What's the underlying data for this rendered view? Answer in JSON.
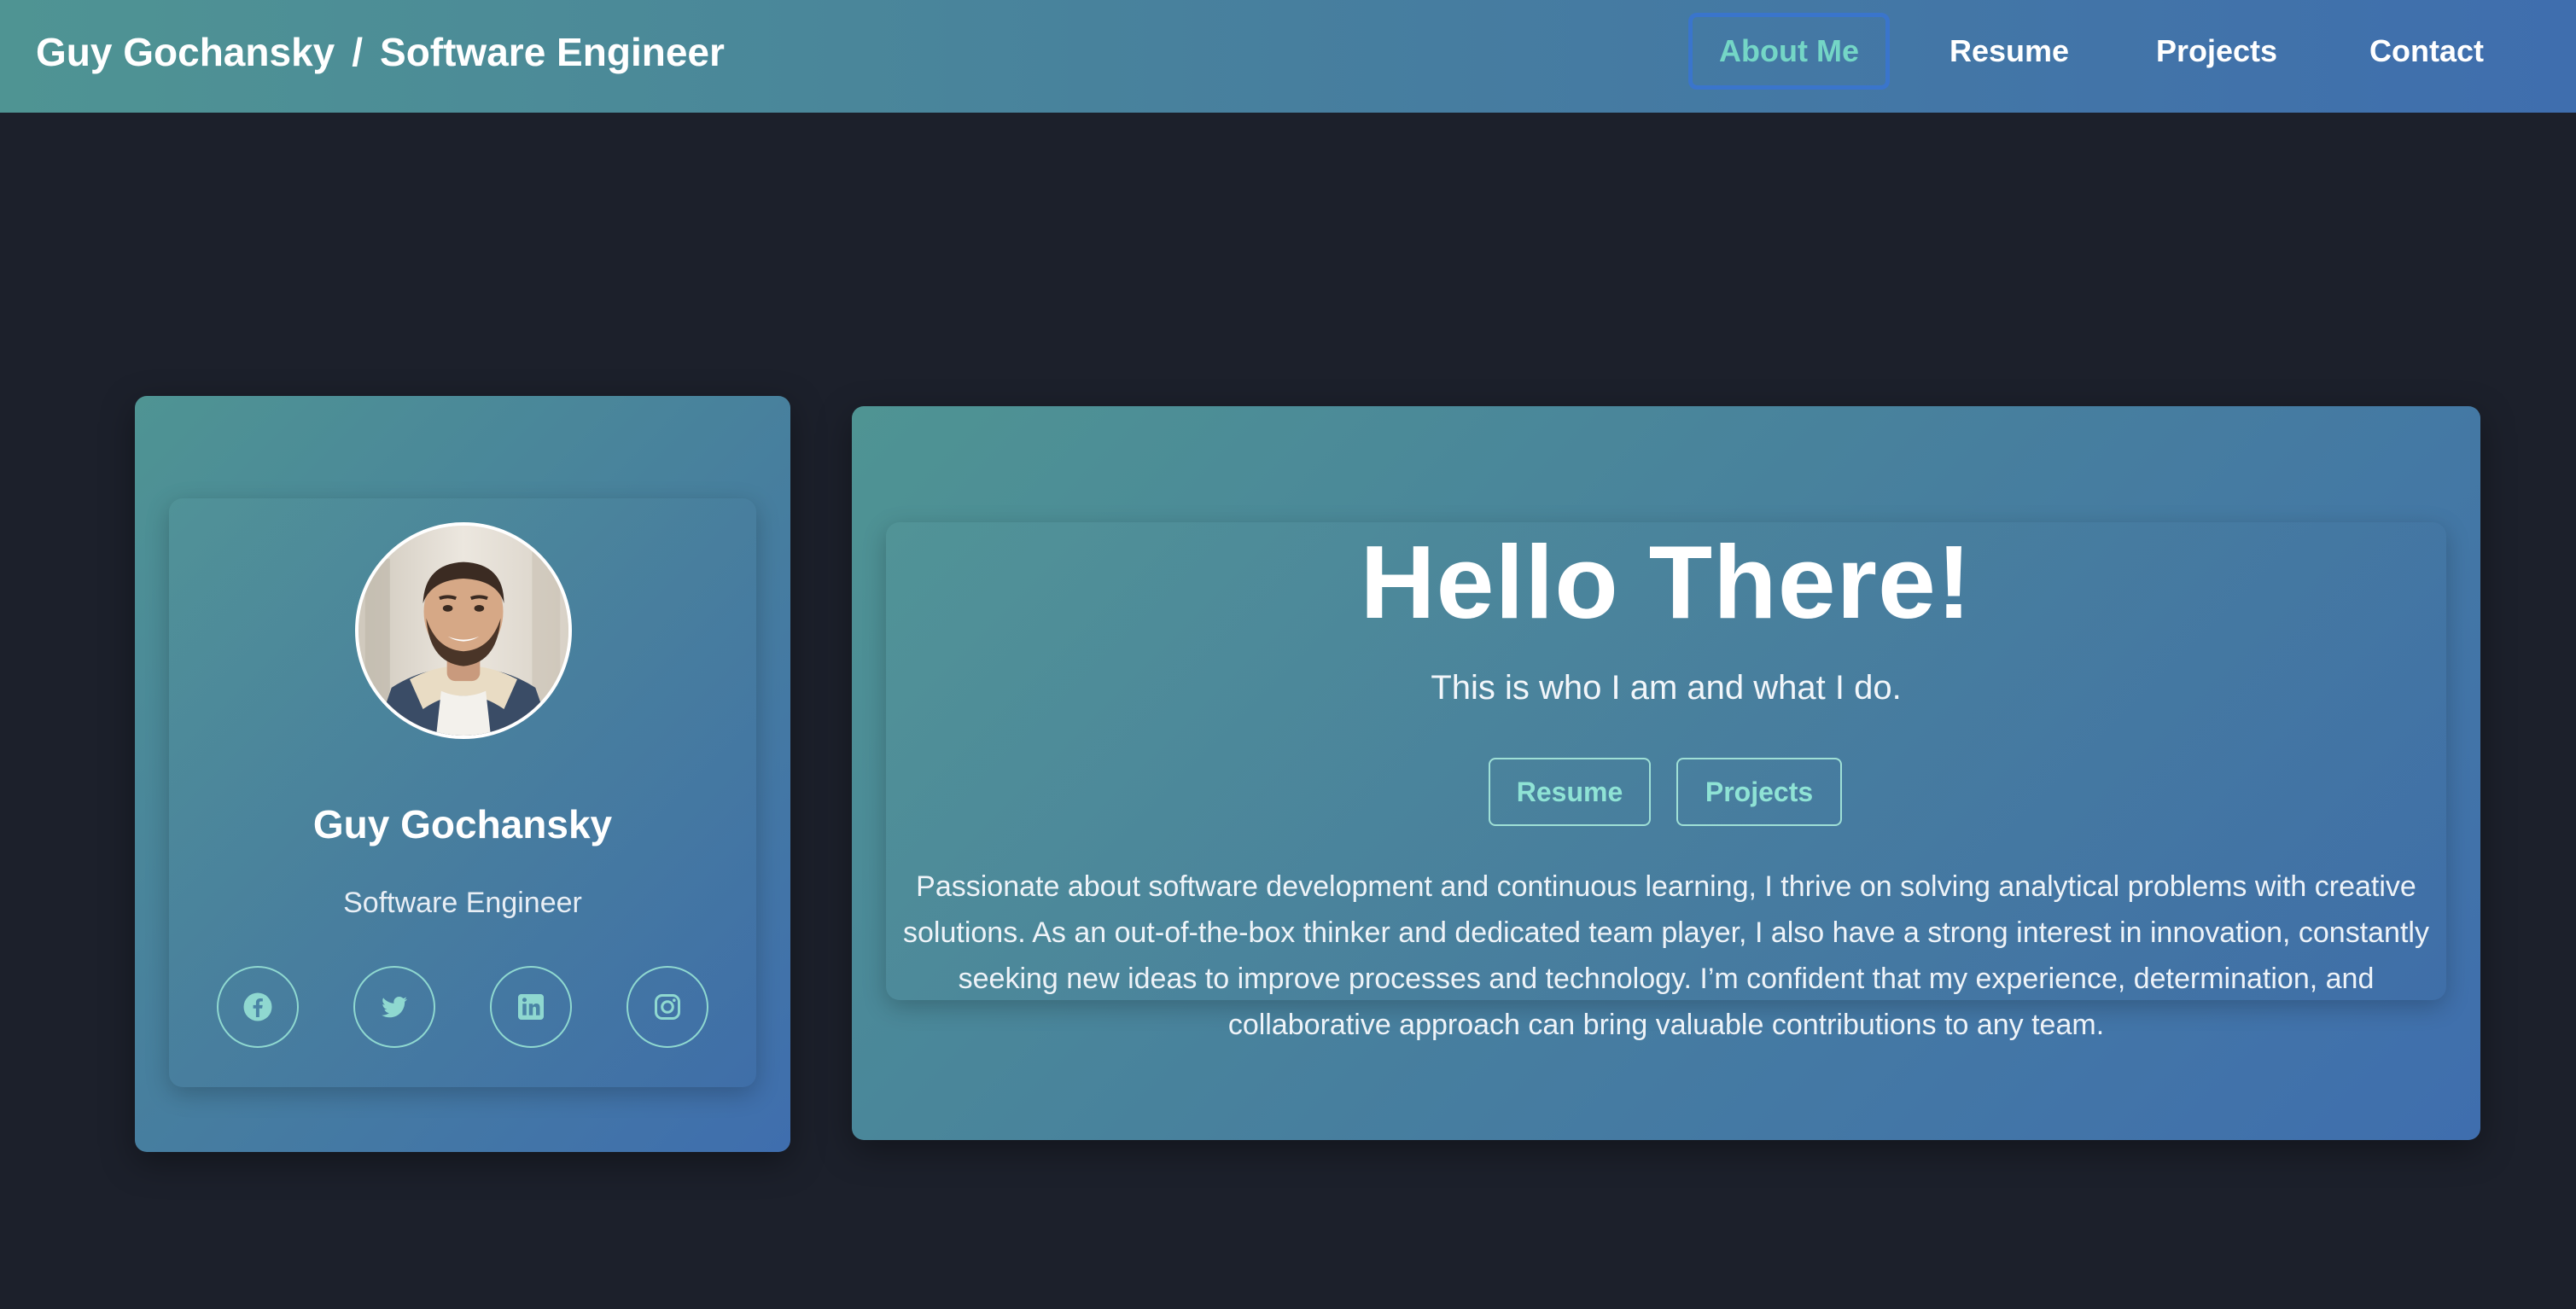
{
  "header": {
    "brand_name": "Guy Gochansky",
    "brand_separator": "/",
    "brand_role": "Software Engineer",
    "nav": [
      {
        "label": "About Me",
        "active": true
      },
      {
        "label": "Resume",
        "active": false
      },
      {
        "label": "Projects",
        "active": false
      },
      {
        "label": "Contact",
        "active": false
      }
    ]
  },
  "profile": {
    "name": "Guy Gochansky",
    "title": "Software Engineer",
    "social_icons": [
      "facebook-icon",
      "twitter-icon",
      "linkedin-icon",
      "instagram-icon"
    ]
  },
  "hero": {
    "heading": "Hello There!",
    "subtitle": "This is who I am and what I do.",
    "buttons": [
      {
        "label": "Resume"
      },
      {
        "label": "Projects"
      }
    ],
    "description": "Passionate about software development and continuous learning, I thrive on solving analytical problems with creative solutions. As an out-of-the-box thinker and dedicated team player, I also have a strong interest in innovation, constantly seeking new ideas to improve processes and technology. I’m confident that my experience, determination, and collaborative approach can bring valuable contributions to any team."
  },
  "colors": {
    "page_background": "#1c202b",
    "gradient_start": "#4f9493",
    "gradient_end": "#3f6eae",
    "accent_teal": "#74d6c6",
    "active_border": "#3a75cc",
    "text_white": "#ffffff"
  }
}
